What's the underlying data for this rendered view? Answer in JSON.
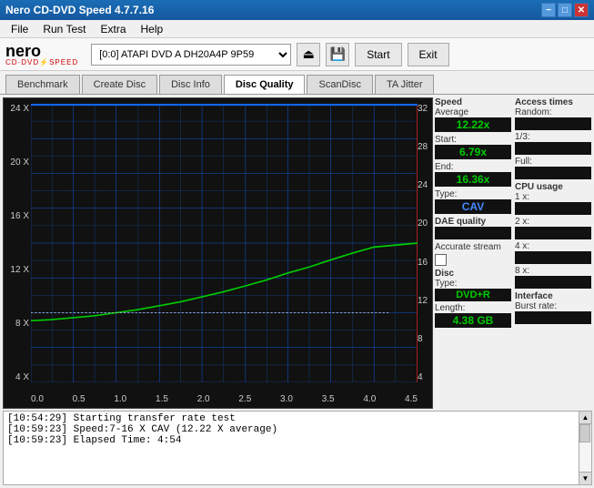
{
  "titlebar": {
    "title": "Nero CD-DVD Speed 4.7.7.16",
    "min_label": "−",
    "max_label": "□",
    "close_label": "✕"
  },
  "menubar": {
    "items": [
      "File",
      "Run Test",
      "Extra",
      "Help"
    ]
  },
  "toolbar": {
    "drive_value": "[0:0]  ATAPI DVD A  DH20A4P 9P59",
    "start_label": "Start",
    "exit_label": "Exit"
  },
  "tabs": {
    "items": [
      "Benchmark",
      "Create Disc",
      "Disc Info",
      "Disc Quality",
      "ScanDisc",
      "TA Jitter"
    ],
    "active": "Disc Quality"
  },
  "chart": {
    "y_axis_left": [
      "24 X",
      "20 X",
      "16 X",
      "12 X",
      "8 X",
      "4 X"
    ],
    "y_axis_right": [
      "32",
      "28",
      "24",
      "20",
      "16",
      "12",
      "8",
      "4"
    ],
    "x_axis": [
      "0.0",
      "0.5",
      "1.0",
      "1.5",
      "2.0",
      "2.5",
      "3.0",
      "3.5",
      "4.0",
      "4.5"
    ]
  },
  "stats": {
    "speed_label": "Speed",
    "average_label": "Average",
    "average_value": "12.22x",
    "start_label": "Start:",
    "start_value": "6.79x",
    "end_label": "End:",
    "end_value": "16.36x",
    "type_label": "Type:",
    "type_value": "CAV",
    "dae_quality_label": "DAE quality",
    "accurate_stream_label": "Accurate stream",
    "disc_label": "Disc",
    "disc_type_label": "Type:",
    "disc_type_value": "DVD+R",
    "length_label": "Length:",
    "length_value": "4.38 GB"
  },
  "access_times": {
    "header": "Access times",
    "random_label": "Random:",
    "one_third_label": "1/3:",
    "full_label": "Full:"
  },
  "cpu_usage": {
    "header": "CPU usage",
    "x1_label": "1 x:",
    "x2_label": "2 x:",
    "x4_label": "4 x:",
    "x8_label": "8 x:"
  },
  "interface": {
    "header": "Interface",
    "burst_rate_label": "Burst rate:"
  },
  "log": {
    "lines": [
      "[10:54:29]  Starting transfer rate test",
      "[10:59:23]  Speed:7-16 X CAV (12.22 X average)",
      "[10:59:23]  Elapsed Time: 4:54"
    ]
  }
}
